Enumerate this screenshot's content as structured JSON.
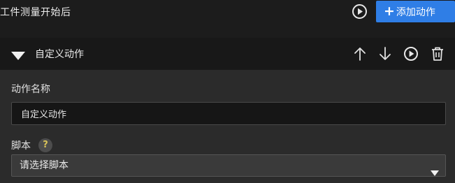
{
  "header": {
    "title": "工件测量开始后",
    "play_icon": "play-circle-icon",
    "add_button_label": "添加动作",
    "add_button_icon": "plus-icon",
    "accent_color": "#2f7ee6"
  },
  "section": {
    "title": "自定义动作",
    "collapse_icon": "triangle-down-icon",
    "tools": [
      "arrow-up-icon",
      "arrow-down-icon",
      "play-circle-icon",
      "trash-icon"
    ]
  },
  "form": {
    "name_label": "动作名称",
    "name_value": "自定义动作",
    "script_label": "脚本",
    "help_symbol": "?",
    "script_select_value": "请选择脚本"
  }
}
